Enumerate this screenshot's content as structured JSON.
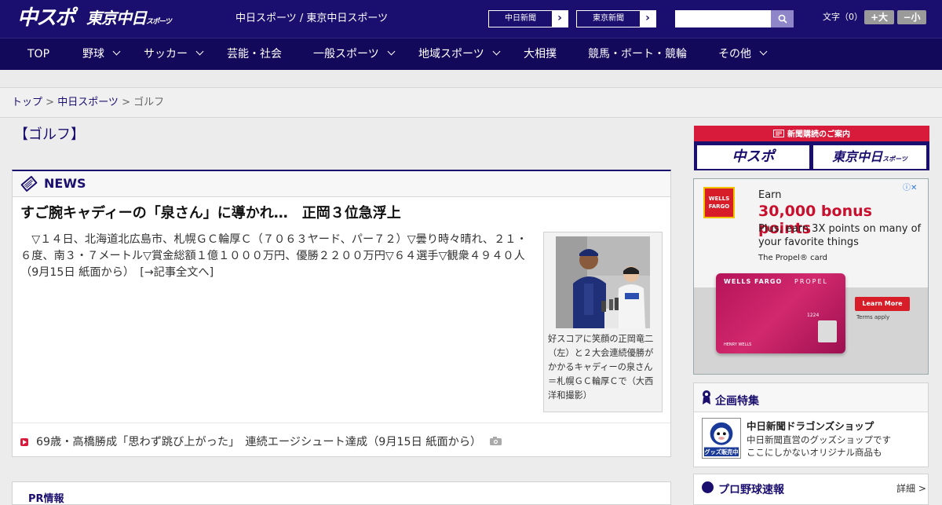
{
  "header": {
    "logo_chuspo": "中スポ",
    "logo_tokyo": "東京中日",
    "logo_tokyo_small": "スポーツ",
    "site_links": "中日スポーツ / 東京中日スポーツ",
    "paper_buttons": [
      "中日新聞",
      "東京新聞"
    ],
    "search_placeholder": "",
    "font_size_label": "文字（0）",
    "font_plus": "+大",
    "font_minus": "−小"
  },
  "nav": {
    "items": [
      "TOP",
      "野球",
      "サッカー",
      "芸能・社会",
      "一般スポーツ",
      "地域スポーツ",
      "大相撲",
      "競馬・ボート・競輪",
      "その他"
    ]
  },
  "breadcrumb": {
    "top": "トップ",
    "sep1": " > ",
    "section": "中日スポーツ",
    "sep2": " > ",
    "current": "ゴルフ"
  },
  "page": {
    "title": "【ゴルフ】"
  },
  "news": {
    "label": "NEWS",
    "headline": "すご腕キャディーの「泉さん」に導かれ…　正岡３位急浮上",
    "body": "▽１４日、北海道北広島市、札幌ＧＣ輪厚Ｃ（７０６３ヤード、パー７２）▽曇り時々晴れ、２１・６度、南３・７メートル▽賞金総額１億１０００万円、優勝２２００万円▽６４選手▽観衆４９４０人（9月15日 紙面から）",
    "more": "[→記事全文へ]",
    "caption": "好スコアに笑顔の正岡竜二（左）と２大会連続優勝がかかるキャディーの泉さん＝札幌ＧＣ輪厚Ｃで（大西洋和撮影）",
    "sub_item": "69歳・高橋勝成「思わず跳び上がった」　連続エージシュート達成（9月15日 紙面から）"
  },
  "next_box": {
    "label": "PR情報"
  },
  "sidebar": {
    "subscribe_head": "新聞購読のご案内",
    "subscribe_buttons": [
      "中スポ",
      "東京中日"
    ],
    "subscribe_small": "スポーツ",
    "ad": {
      "logo": "WELLS FARGO",
      "earn": "Earn",
      "big": "30,000 bonus points",
      "plus": "Plus, earn 3X points on many of your favorite things",
      "propel": "The Propel® card",
      "card_brand": "WELLS FARGO",
      "card_product": "PROPEL",
      "card_number": "1224",
      "card_name": "HENRY WELLS",
      "learn_more": "Learn More",
      "terms": "Terms apply",
      "adinfo": "ⓘ✕"
    },
    "plan": {
      "label": "企画特集",
      "item_title": "中日新聞ドラゴンズショップ",
      "item_desc1": "中日新聞直営のグッズショップです",
      "item_desc2": "ここにしかないオリジナル商品も",
      "img_text": "グッズ販売中"
    },
    "baseball": {
      "label": "プロ野球速報",
      "more": "詳細 >"
    }
  },
  "colors": {
    "brand_navy": "#1a0f6e",
    "accent_red": "#d81b3a"
  }
}
